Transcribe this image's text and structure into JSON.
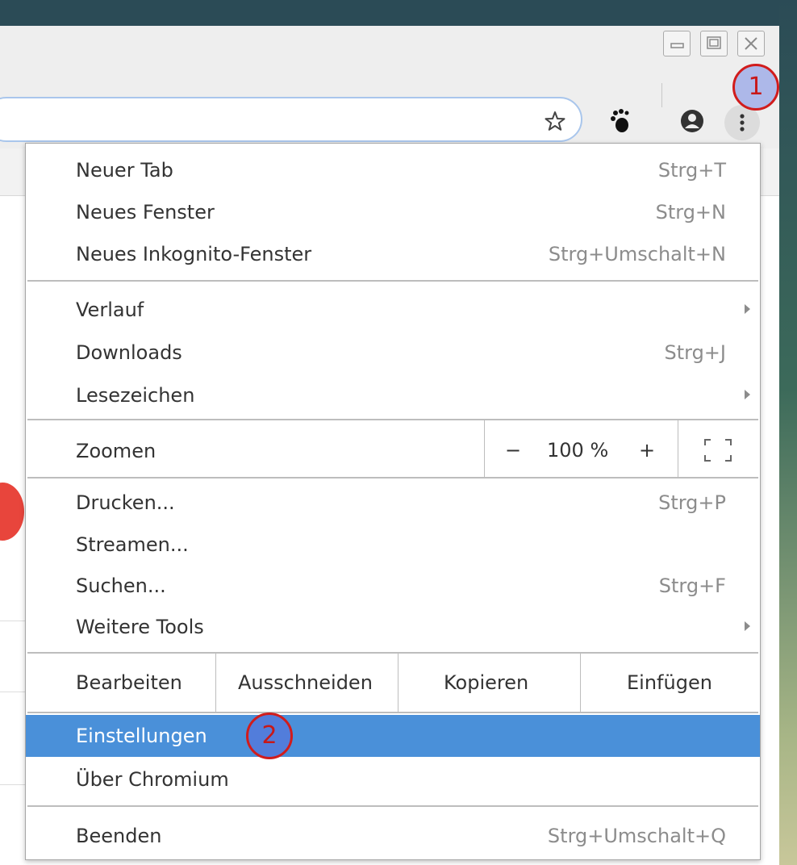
{
  "window_controls": {
    "minimize_icon": "minimize-icon",
    "maximize_icon": "maximize-icon",
    "close_icon": "close-icon"
  },
  "toolbar": {
    "icons": [
      "star-icon",
      "gnome-foot-icon",
      "profile-icon",
      "more-vert-icon"
    ]
  },
  "menu": {
    "group1": [
      {
        "label": "Neuer Tab",
        "shortcut": "Strg+T"
      },
      {
        "label": "Neues Fenster",
        "shortcut": "Strg+N"
      },
      {
        "label": "Neues Inkognito-Fenster",
        "shortcut": "Strg+Umschalt+N"
      }
    ],
    "group2": [
      {
        "label": "Verlauf",
        "submenu": true
      },
      {
        "label": "Downloads",
        "shortcut": "Strg+J"
      },
      {
        "label": "Lesezeichen",
        "submenu": true
      }
    ],
    "zoom": {
      "label": "Zoomen",
      "minus": "−",
      "value": "100 %",
      "plus": "+",
      "fullscreen_icon": "fullscreen-icon"
    },
    "group3": [
      {
        "label": "Drucken...",
        "shortcut": "Strg+P"
      },
      {
        "label": "Streamen..."
      },
      {
        "label": "Suchen...",
        "shortcut": "Strg+F"
      },
      {
        "label": "Weitere Tools",
        "submenu": true
      }
    ],
    "edit": {
      "label": "Bearbeiten",
      "cut": "Ausschneiden",
      "copy": "Kopieren",
      "paste": "Einfügen"
    },
    "group4": [
      {
        "label": "Einstellungen",
        "highlighted": true
      },
      {
        "label": "Über Chromium"
      }
    ],
    "group5": [
      {
        "label": "Beenden",
        "shortcut": "Strg+Umschalt+Q"
      }
    ]
  },
  "annotations": {
    "badge1": "1",
    "badge2": "2"
  },
  "colors": {
    "highlight": "#4a90d9",
    "annotation": "#d11c1c"
  }
}
